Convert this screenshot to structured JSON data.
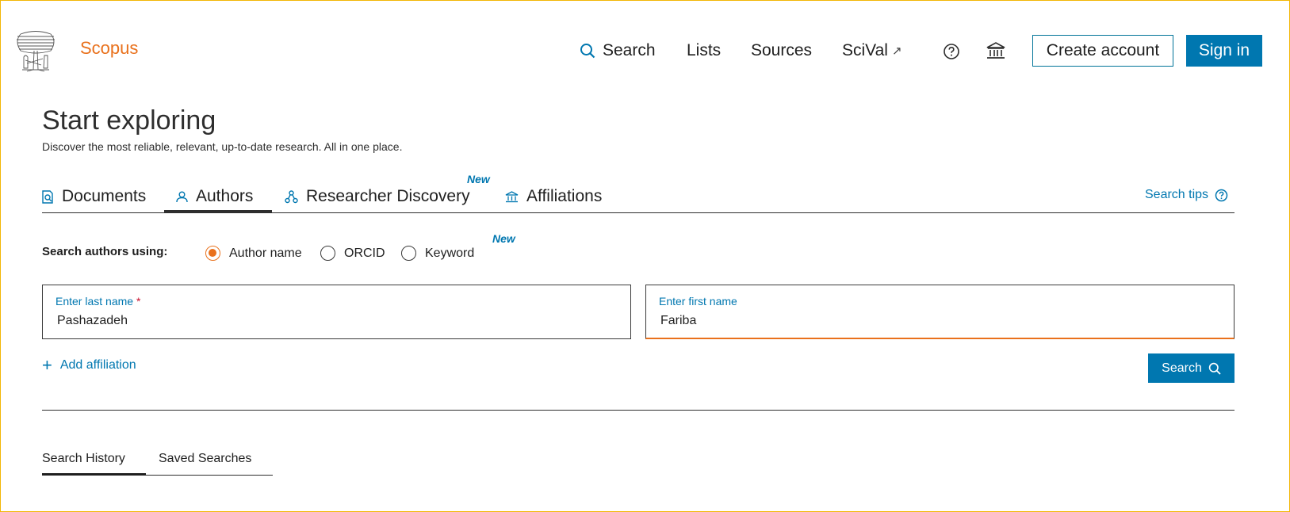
{
  "header": {
    "brand": "Scopus",
    "nav": {
      "search": "Search",
      "lists": "Lists",
      "sources": "Sources",
      "scival": "SciVal",
      "scival_ext": "↗"
    },
    "create_account": "Create account",
    "sign_in": "Sign in"
  },
  "hero": {
    "title": "Start exploring",
    "subtitle": "Discover the most reliable, relevant, up-to-date research. All in one place."
  },
  "tabs": {
    "items": [
      {
        "label": "Documents",
        "icon": "document-search-icon"
      },
      {
        "label": "Authors",
        "icon": "person-icon"
      },
      {
        "label": "Researcher Discovery",
        "icon": "network-icon"
      },
      {
        "label": "Affiliations",
        "icon": "institution-icon"
      }
    ],
    "active": "Authors",
    "new_badge": "New",
    "search_tips": "Search tips"
  },
  "search_using": {
    "label": "Search authors using:",
    "options": [
      "Author name",
      "ORCID",
      "Keyword"
    ],
    "selected": "Author name",
    "new_badge": "New"
  },
  "form": {
    "last_name_label": "Enter last name",
    "required_mark": "*",
    "last_name_value": "Pashazadeh",
    "first_name_label": "Enter first name",
    "first_name_value": "Fariba",
    "add_affiliation": "Add affiliation",
    "search_button": "Search"
  },
  "bottom_tabs": {
    "items": [
      "Search History",
      "Saved Searches"
    ],
    "active": "Search History"
  },
  "colors": {
    "brand_orange": "#e9711c",
    "primary_blue": "#0077b0",
    "frame_yellow": "#f2b705"
  }
}
